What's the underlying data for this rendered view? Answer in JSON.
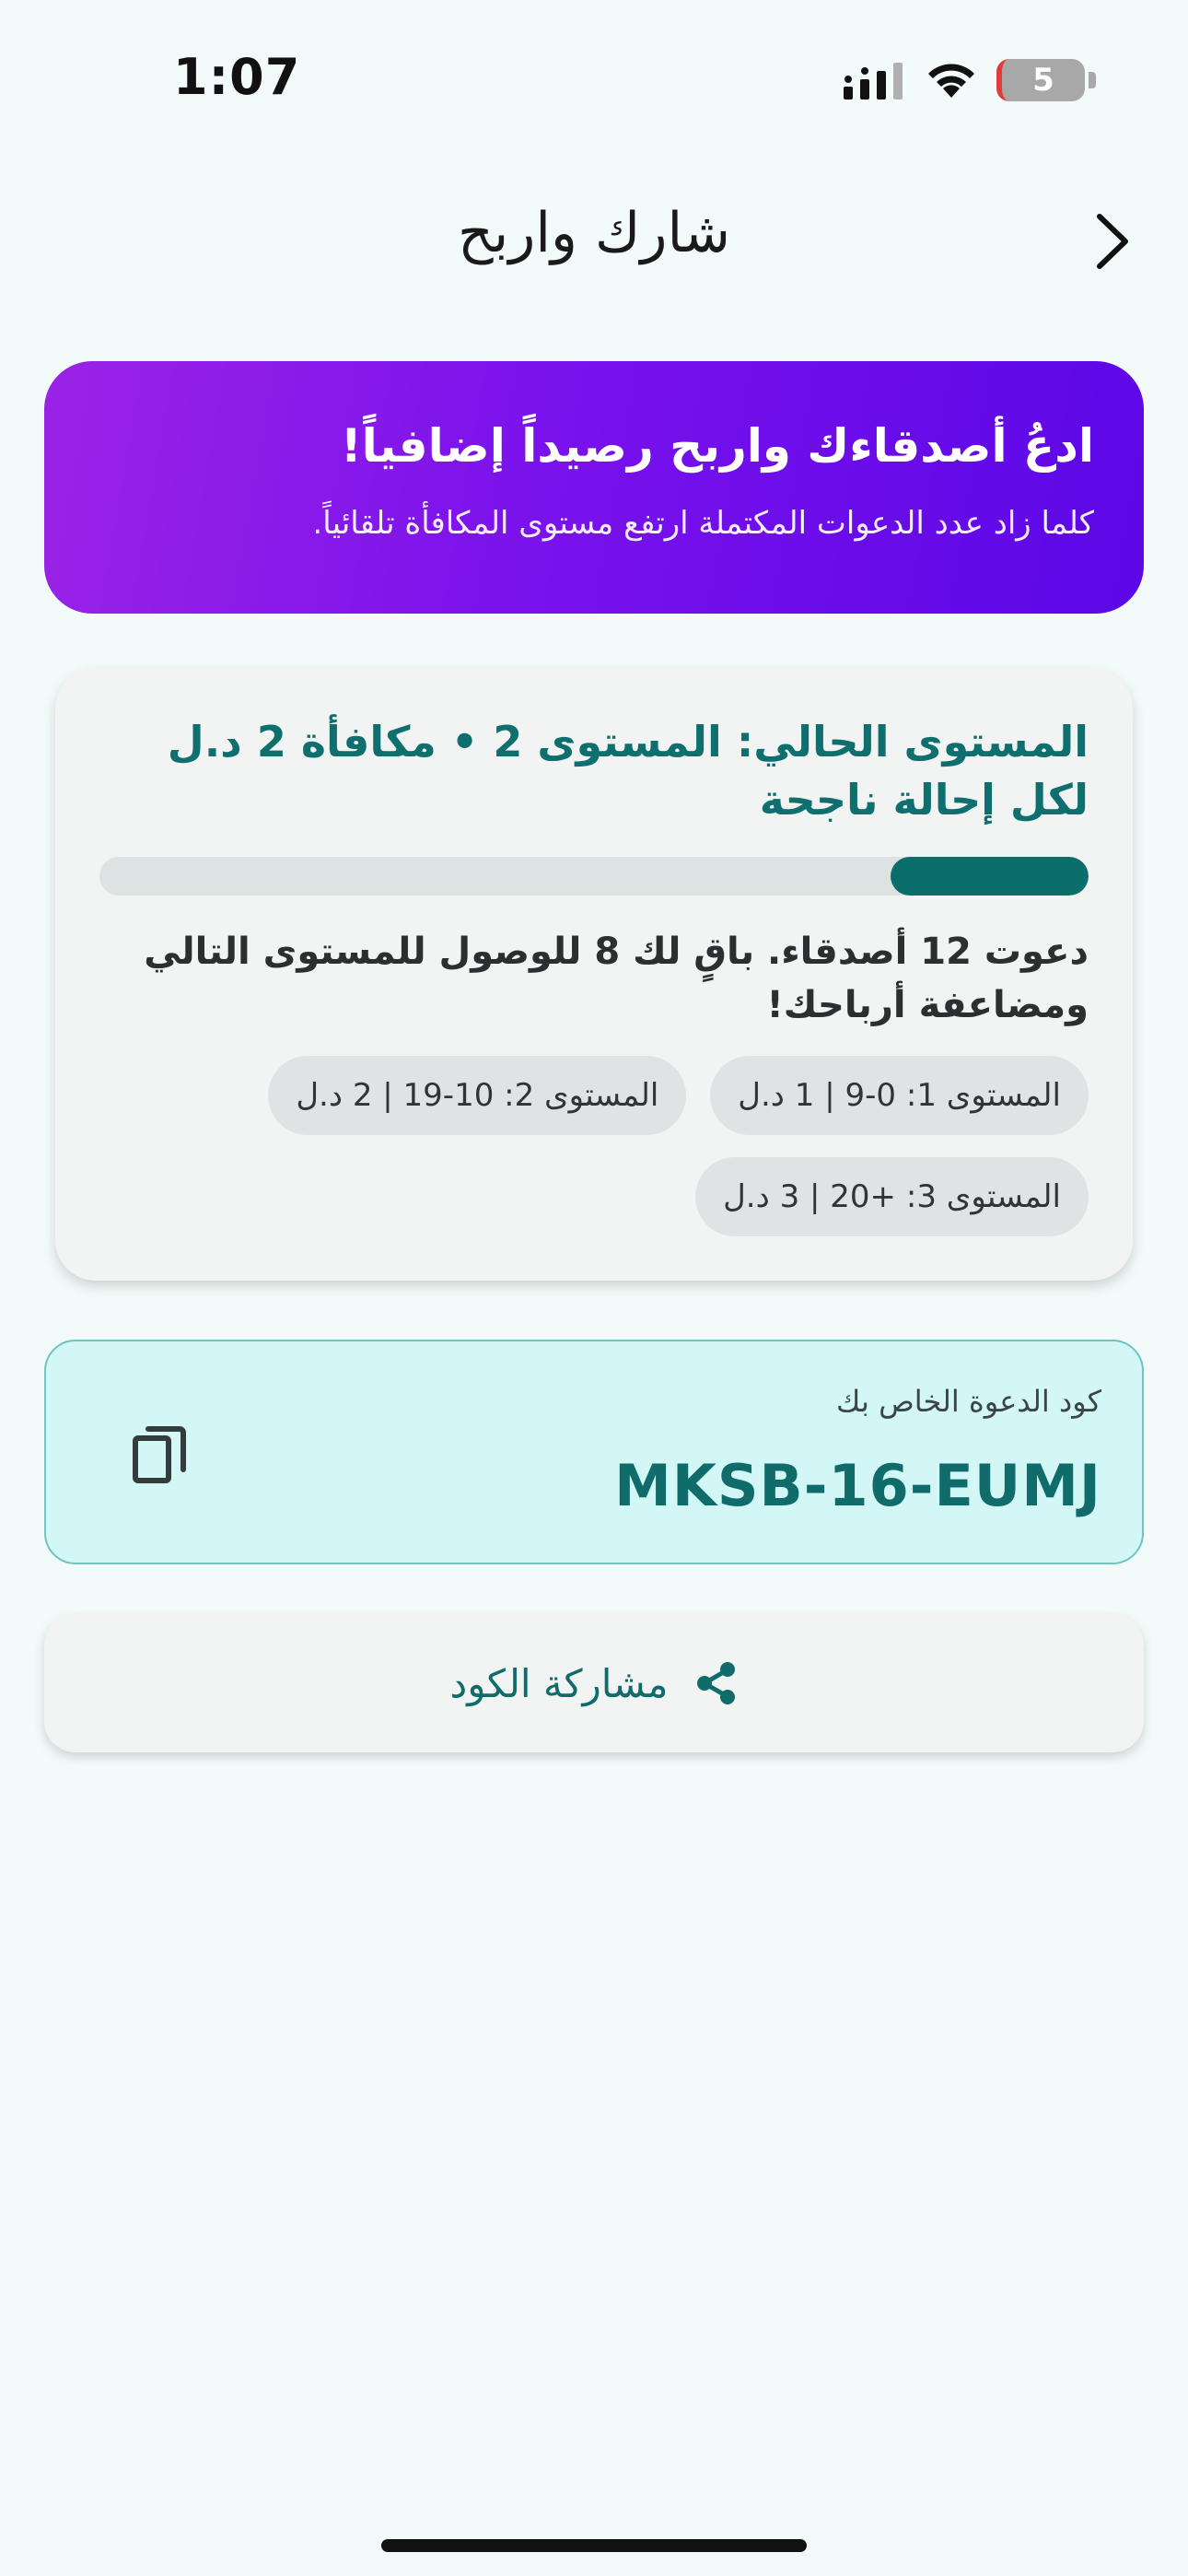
{
  "status_bar": {
    "time": "1:07",
    "battery_level": "5",
    "icons": [
      "signal-icon",
      "wifi-icon",
      "battery-icon"
    ]
  },
  "header": {
    "title": "شارك واربح",
    "back_icon": "chevron-right-icon"
  },
  "hero": {
    "title": "ادعُ أصدقاءك واربح رصيداً إضافياً!",
    "subtitle": "كلما زاد عدد الدعوات المكتملة ارتفع مستوى المكافأة تلقائياً.",
    "gradient_colors": [
      "#9b23e6",
      "#5b07e6"
    ]
  },
  "level_card": {
    "title": "المستوى الحالي: المستوى 2 • مكافأة 2 د.ل لكل إحالة ناجحة",
    "progress_fraction": 0.2,
    "progress_text": "دعوت 12 أصدقاء. باقٍ لك 8 للوصول للمستوى التالي ومضاعفة أرباحك!",
    "chips": [
      "المستوى 1: 0-9 | 1 د.ل",
      "المستوى 2: 10-19 | 2 د.ل",
      "المستوى 3: +20 | 3 د.ل"
    ],
    "accent_color": "#0c6e6b"
  },
  "invite_code": {
    "label": "كود الدعوة الخاص بك",
    "value": "MKSB-16-EUMJ",
    "copy_icon": "copy-icon"
  },
  "share": {
    "label": "مشاركة الكود",
    "icon": "share-icon"
  }
}
